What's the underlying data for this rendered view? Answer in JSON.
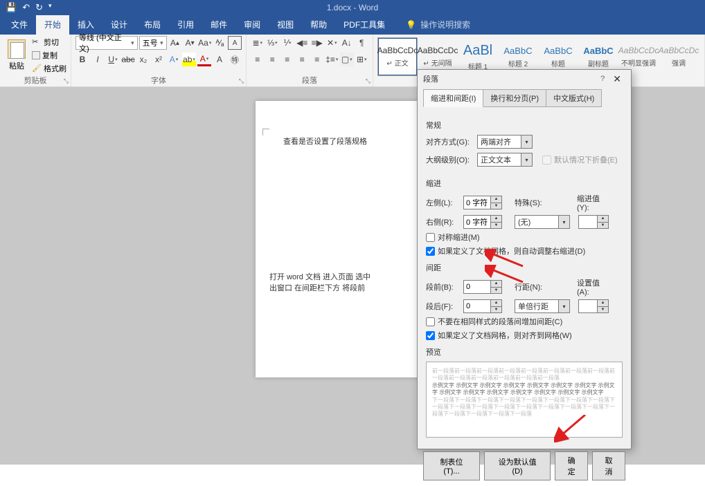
{
  "titlebar": {
    "doc_title": "1.docx - Word"
  },
  "tabs": {
    "file": "文件",
    "home": "开始",
    "insert": "插入",
    "design": "设计",
    "layout": "布局",
    "references": "引用",
    "mailings": "邮件",
    "review": "审阅",
    "view": "视图",
    "help": "帮助",
    "pdf": "PDF工具集",
    "tellme": "操作说明搜索"
  },
  "clipboard": {
    "paste": "粘贴",
    "cut": "剪切",
    "copy": "复制",
    "format_painter": "格式刷",
    "group": "剪贴板"
  },
  "font": {
    "family": "等线 (中文正文)",
    "size": "五号",
    "group": "字体"
  },
  "paragraph": {
    "group": "段落"
  },
  "styles": [
    {
      "preview": "AaBbCcDc",
      "name": "↵ 正文",
      "cls": ""
    },
    {
      "preview": "AaBbCcDc",
      "name": "↵ 无间隔",
      "cls": ""
    },
    {
      "preview": "AaBl",
      "name": "标题 1",
      "cls": "big"
    },
    {
      "preview": "AaBbC",
      "name": "标题 2",
      "cls": "med"
    },
    {
      "preview": "AaBbC",
      "name": "标题",
      "cls": "med"
    },
    {
      "preview": "AaBbC",
      "name": "副标题",
      "cls": "medb"
    },
    {
      "preview": "AaBbCcDc",
      "name": "不明显强调",
      "cls": "gray"
    },
    {
      "preview": "AaBbCcDc",
      "name": "强调",
      "cls": "gray"
    }
  ],
  "doc": {
    "line1": "查看是否设置了段落规格",
    "line2a": "打开 word 文档   进入页面   选中",
    "line2b": "出窗口   在间距栏下方   将段前"
  },
  "dialog": {
    "title": "段落",
    "tabs": {
      "t1": "缩进和间距(I)",
      "t2": "换行和分页(P)",
      "t3": "中文版式(H)"
    },
    "general": "常规",
    "alignment_label": "对齐方式(G):",
    "alignment_value": "两端对齐",
    "outline_label": "大纲级别(O):",
    "outline_value": "正文文本",
    "collapse": "默认情况下折叠(E)",
    "indent": "缩进",
    "left_label": "左侧(L):",
    "left_value": "0 字符",
    "right_label": "右侧(R):",
    "right_value": "0 字符",
    "special_label": "特殊(S):",
    "special_value": "(无)",
    "by_label": "缩进值(Y):",
    "by_value": "",
    "mirror": "对称缩进(M)",
    "grid_indent": "如果定义了文档网格，则自动调整右缩进(D)",
    "spacing": "间距",
    "before_label": "段前(B):",
    "before_value": "0",
    "after_label": "段后(F):",
    "after_value": "0",
    "line_spacing_label": "行距(N):",
    "line_spacing_value": "单倍行距",
    "at_label": "设置值(A):",
    "at_value": "",
    "no_space_same": "不要在相同样式的段落间增加间距(C)",
    "snap_grid": "如果定义了文档网格，则对齐到网格(W)",
    "preview": "预览",
    "preview_text_light": "前一段落前一段落前一段落前一段落前一段落前一段落前一段落前一段落前一段落前一段落前一段落前一段落前一段落前一段落",
    "preview_text_sample": "示例文字 示例文字 示例文字 示例文字 示例文字 示例文字 示例文字 示例文字 示例文字 示例文字 示例文字 示例文字 示例文字 示例文字 示例文字",
    "preview_text_after": "下一段落下一段落下一段落下一段落下一段落下一段落下一段落下一段落下一段落下一段落下一段落下一段落下一段落下一段落下一段落下一段落下一段落下一段落下一段落下一段落下一段落",
    "tabs_btn": "制表位(T)...",
    "default_btn": "设为默认值(D)",
    "ok": "确定",
    "cancel": "取消"
  }
}
